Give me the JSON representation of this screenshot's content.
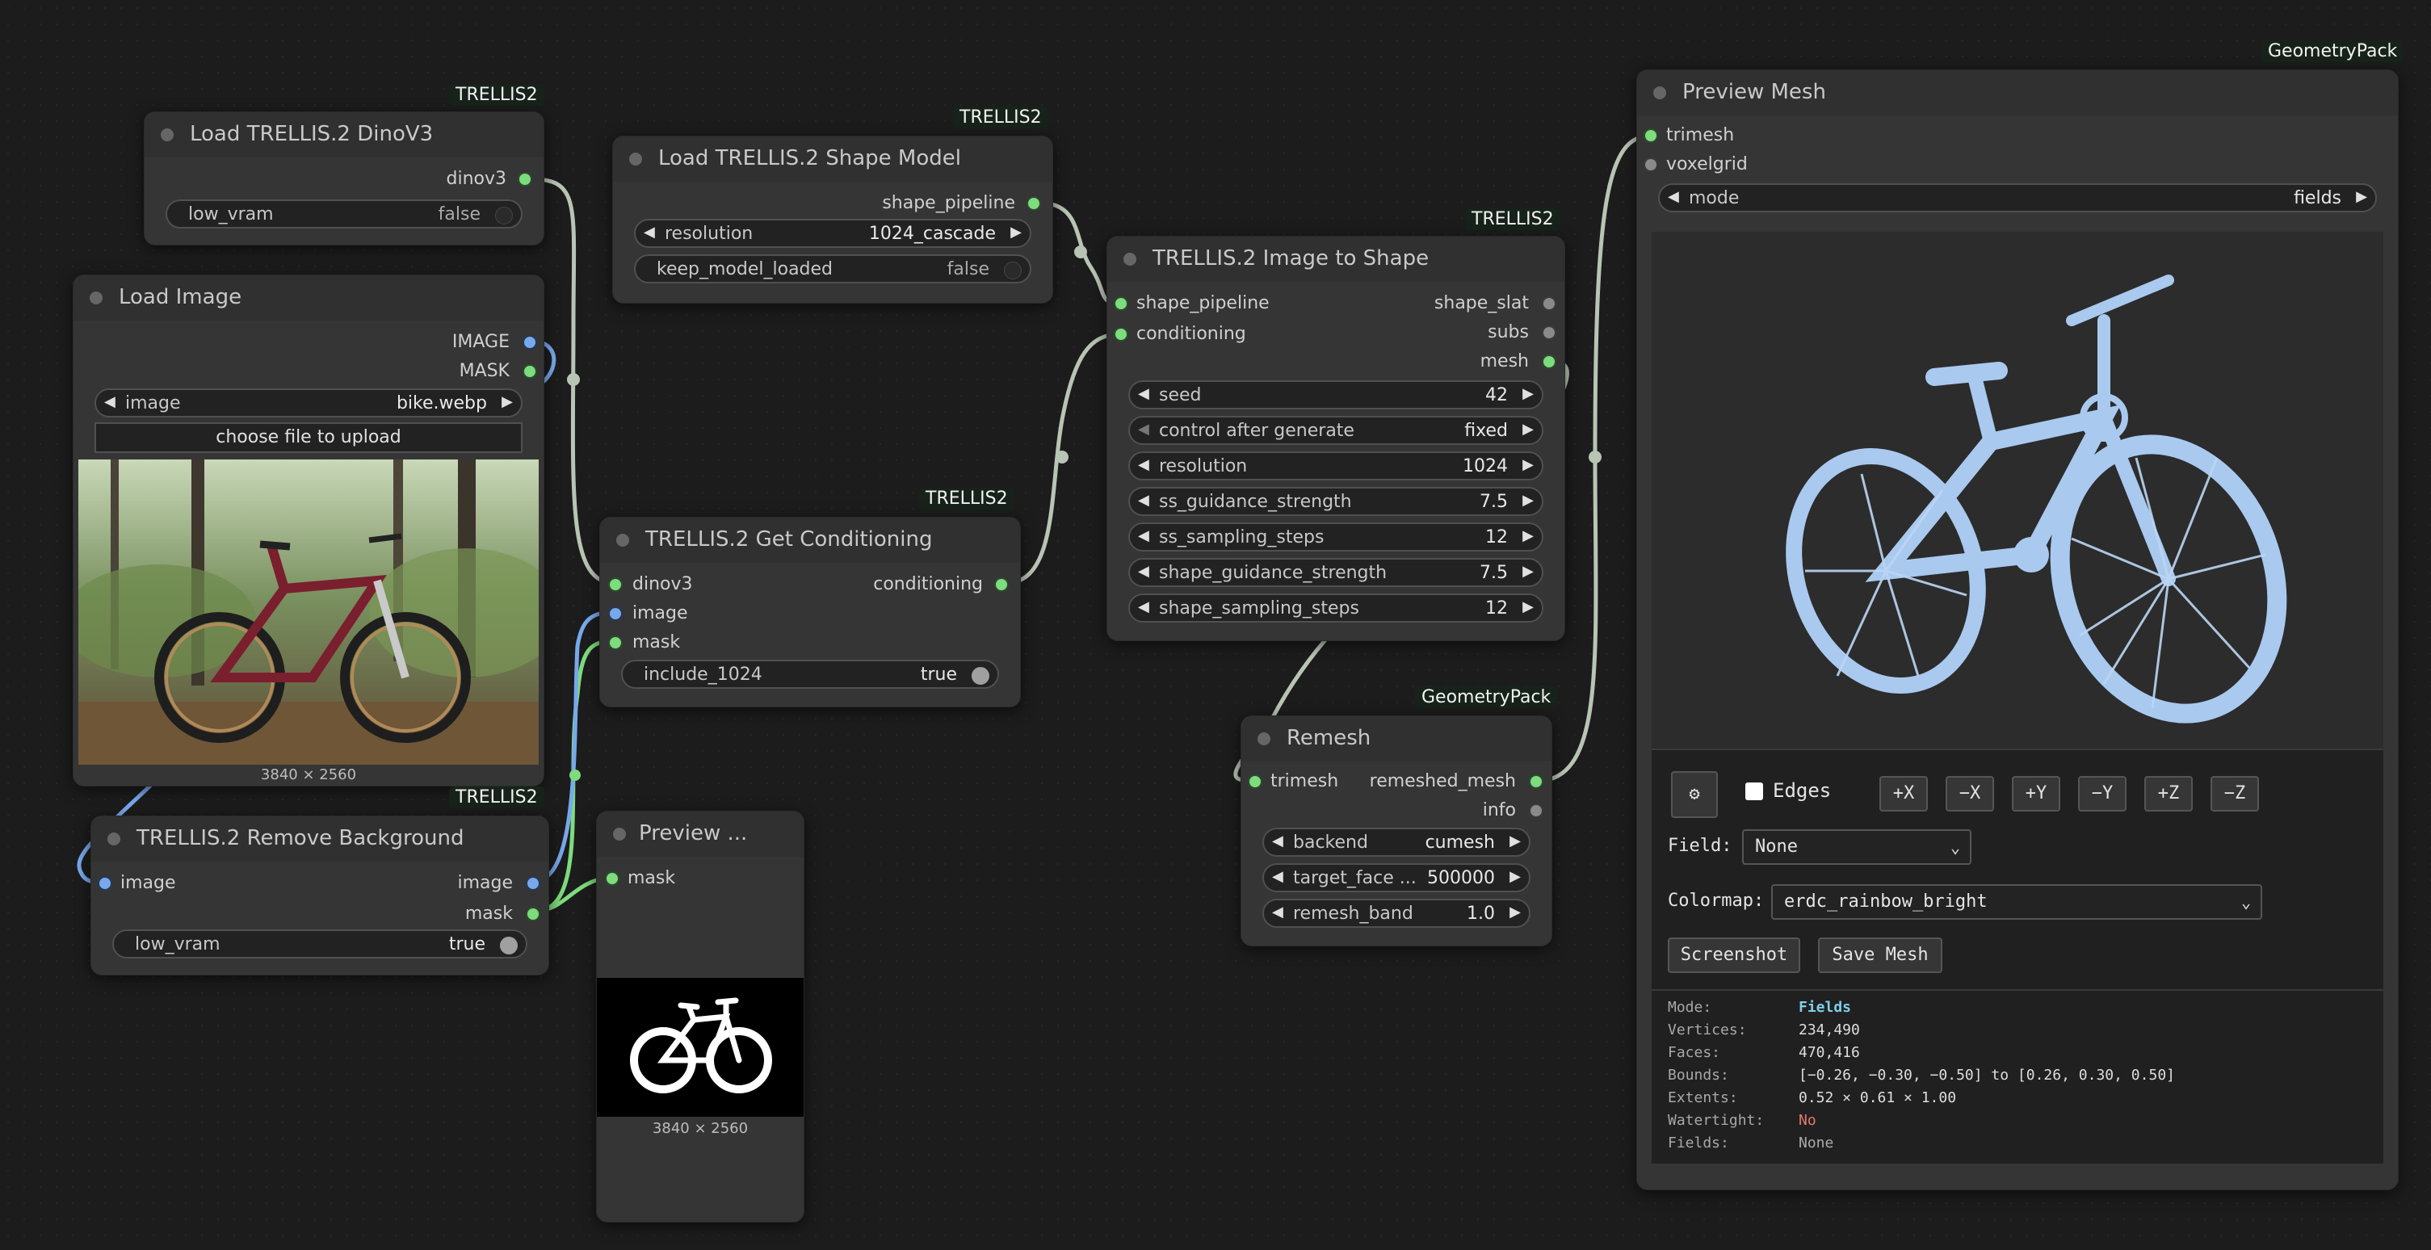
{
  "nodes": {
    "dinov3": {
      "title": "Load TRELLIS.2 DinoV3",
      "badge": "TRELLIS2",
      "output": "dinov3",
      "low_vram": {
        "label": "low_vram",
        "value": "false"
      }
    },
    "load_image": {
      "title": "Load Image",
      "outputs": [
        "IMAGE",
        "MASK"
      ],
      "image": {
        "label": "image",
        "value": "bike.webp"
      },
      "upload_label": "choose file to upload",
      "caption": "3840 × 2560"
    },
    "shape_model": {
      "title": "Load TRELLIS.2 Shape Model",
      "badge": "TRELLIS2",
      "output": "shape_pipeline",
      "resolution": {
        "label": "resolution",
        "value": "1024_cascade"
      },
      "keep_model_loaded": {
        "label": "keep_model_loaded",
        "value": "false"
      }
    },
    "conditioning": {
      "title": "TRELLIS.2 Get Conditioning",
      "badge": "TRELLIS2",
      "inputs": [
        "dinov3",
        "image",
        "mask"
      ],
      "output": "conditioning",
      "include_1024": {
        "label": "include_1024",
        "value": "true"
      }
    },
    "image_to_shape": {
      "title": "TRELLIS.2 Image to Shape",
      "badge": "TRELLIS2",
      "inputs": [
        "shape_pipeline",
        "conditioning"
      ],
      "outputs": [
        "shape_slat",
        "subs",
        "mesh"
      ],
      "widgets": [
        {
          "label": "seed",
          "value": "42"
        },
        {
          "label": "control after generate",
          "value": "fixed"
        },
        {
          "label": "resolution",
          "value": "1024"
        },
        {
          "label": "ss_guidance_strength",
          "value": "7.5"
        },
        {
          "label": "ss_sampling_steps",
          "value": "12"
        },
        {
          "label": "shape_guidance_strength",
          "value": "7.5"
        },
        {
          "label": "shape_sampling_steps",
          "value": "12"
        }
      ]
    },
    "remove_bg": {
      "title": "TRELLIS.2 Remove Background",
      "badge": "TRELLIS2",
      "input": "image",
      "outputs": [
        "image",
        "mask"
      ],
      "low_vram": {
        "label": "low_vram",
        "value": "true"
      }
    },
    "preview_image": {
      "title": "Preview ...",
      "input": "mask",
      "caption": "3840 × 2560"
    },
    "remesh": {
      "title": "Remesh",
      "badge": "GeometryPack",
      "input": "trimesh",
      "outputs": [
        "remeshed_mesh",
        "info"
      ],
      "widgets": [
        {
          "label": "backend",
          "value": "cumesh"
        },
        {
          "label": "target_face ...",
          "value": "500000"
        },
        {
          "label": "remesh_band",
          "value": "1.0"
        }
      ]
    },
    "preview_mesh": {
      "title": "Preview Mesh",
      "badge": "GeometryPack",
      "inputs": [
        "trimesh",
        "voxelgrid"
      ],
      "mode": {
        "label": "mode",
        "value": "fields"
      },
      "edges_label": "Edges",
      "axis_buttons": [
        "+X",
        "−X",
        "+Y",
        "−Y",
        "+Z",
        "−Z"
      ],
      "field_label": "Field:",
      "field_value": "None",
      "colormap_label": "Colormap:",
      "colormap_value": "erdc_rainbow_bright",
      "screenshot_label": "Screenshot",
      "save_label": "Save Mesh",
      "stats": [
        {
          "k": "Mode:",
          "v": "Fields"
        },
        {
          "k": "Vertices:",
          "v": "234,490"
        },
        {
          "k": "Faces:",
          "v": "470,416"
        },
        {
          "k": "Bounds:",
          "v": "[−0.26, −0.30, −0.50] to [0.26, 0.30, 0.50]"
        },
        {
          "k": "Extents:",
          "v": "0.52 × 0.61 × 1.00"
        },
        {
          "k": "Watertight:",
          "v": "No"
        },
        {
          "k": "Fields:",
          "v": "None"
        }
      ]
    }
  },
  "colors": {
    "canvas": "#1c1c1c",
    "node": "#353535",
    "wire": "#b8c4b4",
    "port_green": "#7ddc7d",
    "port_blue": "#78a8ec",
    "mode_highlight": "#7ed0e8",
    "watertight_no": "#e07a6e",
    "mesh": "#a9c9ef"
  },
  "icons": {
    "gear": "gear-icon",
    "arrow_left": "arrow-left-icon",
    "arrow_right": "arrow-right-icon"
  }
}
